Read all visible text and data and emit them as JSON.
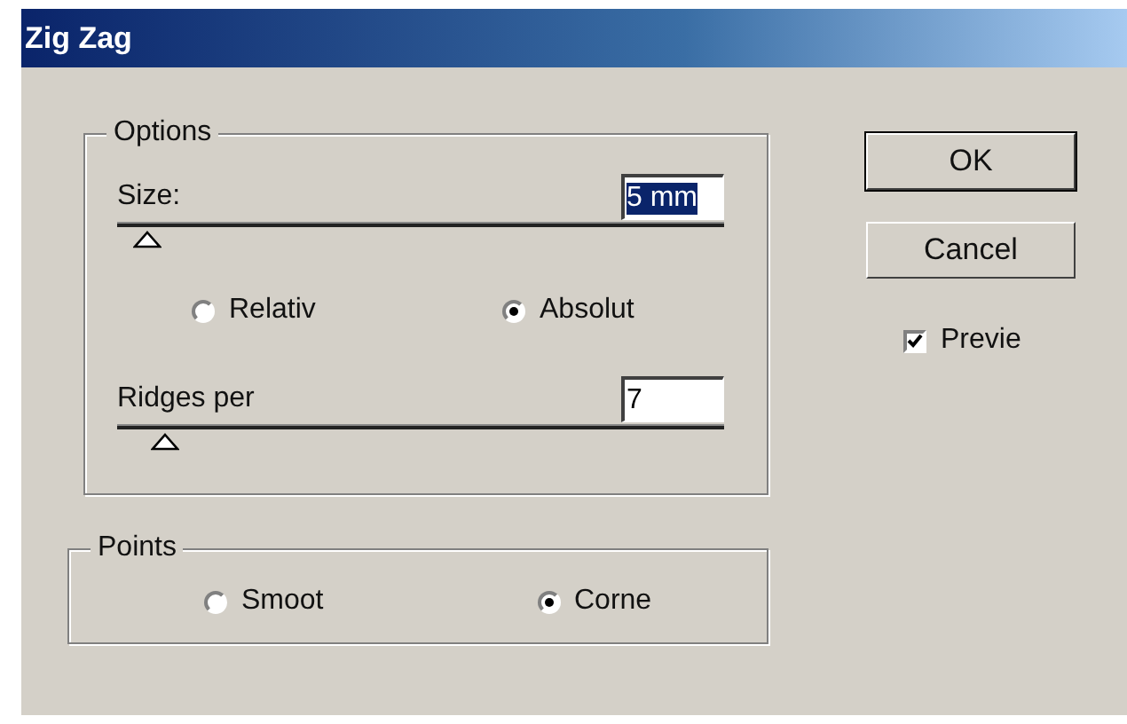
{
  "window": {
    "title": "Zig Zag"
  },
  "options": {
    "title": "Options",
    "size": {
      "label": "Size:",
      "value": "5 mm",
      "value_selected": true,
      "level": 0.05
    },
    "mode": [
      {
        "label": "Relativ",
        "selected": false
      },
      {
        "label": "Absolut",
        "selected": true
      }
    ],
    "ridges": {
      "label": "Ridges per",
      "value": "7",
      "value_selected": false,
      "level": 0.08
    }
  },
  "points": {
    "title": "Points",
    "items": [
      {
        "label": "Smoot",
        "selected": false
      },
      {
        "label": "Corne",
        "selected": true
      }
    ]
  },
  "buttons": [
    {
      "label": "OK",
      "default": true
    },
    {
      "label": "Cancel",
      "default": false
    }
  ],
  "preview": {
    "label": "Previe",
    "checked": true
  }
}
